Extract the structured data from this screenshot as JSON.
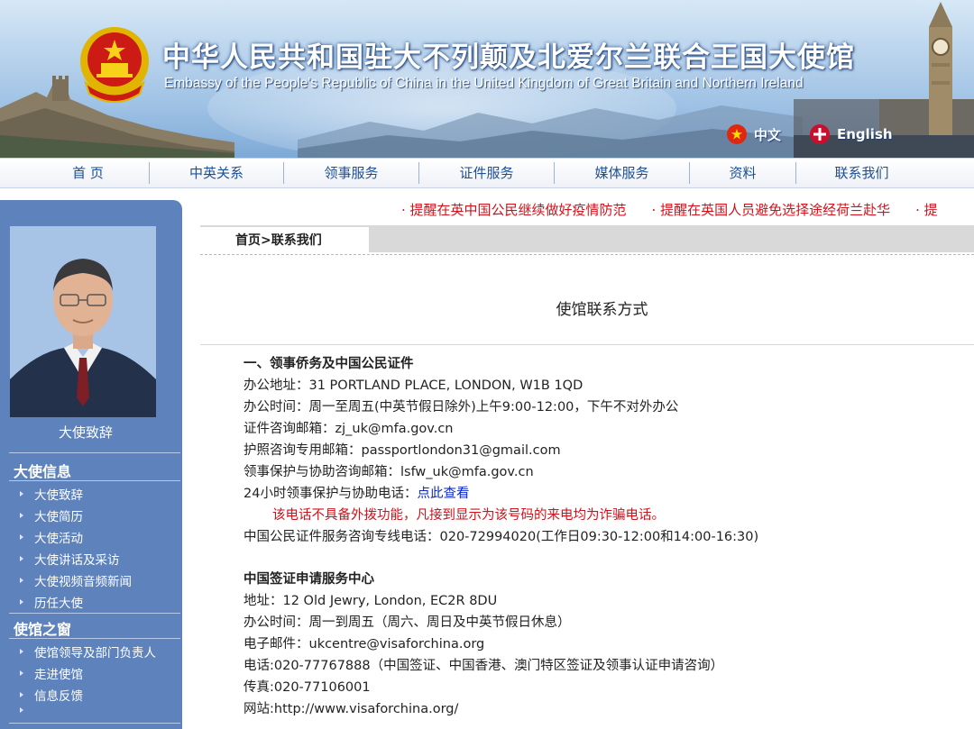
{
  "header": {
    "title_cn": "中华人民共和国驻大不列颠及北爱尔兰联合王国大使馆",
    "title_en": "Embassy of the People's Republic of China in the United Kingdom of Great Britain and Northern Ireland",
    "lang_cn": "中文",
    "lang_en": "English"
  },
  "nav": [
    "首 页",
    "中英关系",
    "领事服务",
    "证件服务",
    "媒体服务",
    "资料",
    "联系我们"
  ],
  "ticker": [
    "· 提醒在英中国公民继续做好疫情防范",
    "· 提醒在英国人员避免选择途经荷兰赴华",
    "· 提"
  ],
  "sidebar": {
    "ambassador_caption": "大使致辞",
    "section1": {
      "title": "大使信息",
      "items": [
        "大使致辞",
        "大使简历",
        "大使活动",
        "大使讲话及采访",
        "大使视频音频新闻",
        "历任大使"
      ]
    },
    "section2": {
      "title": "使馆之窗",
      "items": [
        "使馆领导及部门负责人",
        "走进使馆",
        "信息反馈",
        ""
      ]
    }
  },
  "breadcrumb": {
    "home": "首页",
    "sep": ">",
    "current": "联系我们"
  },
  "content": {
    "title": "使馆联系方式",
    "consular": {
      "heading": "一、领事侨务及中国公民证件",
      "address": "办公地址：31 PORTLAND PLACE, LONDON, W1B 1QD",
      "hours": "办公时间：周一至周五(中英节假日除外)上午9:00-12:00，下午不对外办公",
      "doc_email": "证件咨询邮箱：zj_uk@mfa.gov.cn",
      "passport_email": "护照咨询专用邮箱：passportlondon31@gmail.com",
      "protection_email": "领事保护与协助咨询邮箱：lsfw_uk@mfa.gov.cn",
      "hotline_label": "24小时领事保护与协助电话：",
      "hotline_link": "点此查看",
      "warning": "该电话不具备外拨功能，凡接到显示为该号码的来电均为诈骗电话。",
      "service_line": "中国公民证件服务咨询专线电话：020-72994020(工作日09:30-12:00和14:00-16:30)"
    },
    "visa": {
      "heading": "中国签证申请服务中心",
      "address": "地址：12 Old Jewry, London, EC2R 8DU",
      "hours": "办公时间：周一到周五（周六、周日及中英节假日休息）",
      "email": "电子邮件：ukcentre@visaforchina.org",
      "phone": "电话:020-77767888（中国签证、中国香港、澳门特区签证及领事认证申请咨询）",
      "fax": "传真:020-77106001",
      "website": "网站:http://www.visaforchina.org/"
    }
  },
  "colors": {
    "nav_text": "#1d4f97",
    "sidebar_bg": "#5d82bc",
    "alert_red": "#d0121b",
    "link_blue": "#0b27c8"
  }
}
